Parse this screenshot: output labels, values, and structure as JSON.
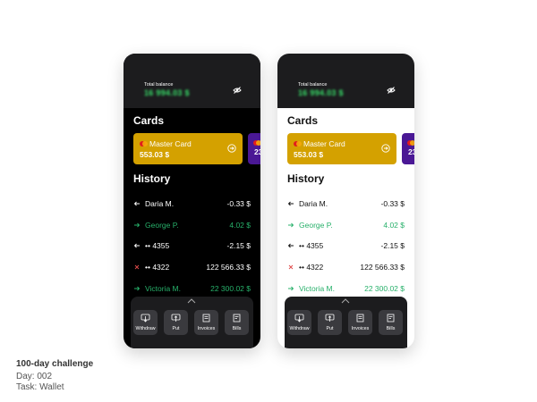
{
  "wallet": {
    "balance_label": "Total balance",
    "balance_value": "16 994.03 $",
    "cards_title": "Cards",
    "history_title": "History",
    "cards": [
      {
        "name": "Master Card",
        "amount": "553.03 $",
        "color": "#d4a100"
      },
      {
        "name": "",
        "amount": "23",
        "color": "#4a1895"
      }
    ],
    "history": [
      {
        "direction": "out",
        "name": "Daria M.",
        "amount": "-0.33 $",
        "green": false
      },
      {
        "direction": "in",
        "name": "George P.",
        "amount": "4.02 $",
        "green": true
      },
      {
        "direction": "out",
        "name": "•• 4355",
        "amount": "-2.15 $",
        "green": false
      },
      {
        "direction": "cancel",
        "name": "•• 4322",
        "amount": "122 566.33 $",
        "green": false
      },
      {
        "direction": "in",
        "name": "Victoria M.",
        "amount": "22 300.02 $",
        "green": true
      }
    ],
    "actions": [
      {
        "label": "Withdraw",
        "icon": "withdraw-icon"
      },
      {
        "label": "Put",
        "icon": "put-icon"
      },
      {
        "label": "Invoices",
        "icon": "invoice-icon"
      },
      {
        "label": "Bills",
        "icon": "bill-icon"
      }
    ]
  },
  "caption": {
    "line1": "100-day challenge",
    "line2": "Day: 002",
    "line3": "Task: Wallet"
  },
  "colors": {
    "accent_green": "#27b06a",
    "card_gold": "#d4a100",
    "card_purple": "#4a1895",
    "dark_bg": "#000000",
    "panel_bg": "#1c1c1e"
  }
}
